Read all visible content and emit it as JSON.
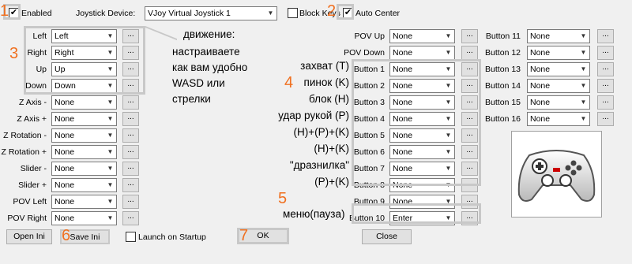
{
  "top": {
    "enabled_label": "Enabled",
    "enabled_checked": true,
    "device_label": "Joystick Device:",
    "device_value": "VJoy Virtual Joystick 1",
    "block_keys_label": "Block Keys",
    "auto_center_label": "Auto Center",
    "auto_center_checked": true
  },
  "left_rows": [
    {
      "label": "Left",
      "value": "Left"
    },
    {
      "label": "Right",
      "value": "Right"
    },
    {
      "label": "Up",
      "value": "Up"
    },
    {
      "label": "Down",
      "value": "Down"
    },
    {
      "label": "Z Axis -",
      "value": "None"
    },
    {
      "label": "Z Axis +",
      "value": "None"
    },
    {
      "label": "Z Rotation -",
      "value": "None"
    },
    {
      "label": "Z Rotation +",
      "value": "None"
    },
    {
      "label": "Slider -",
      "value": "None"
    },
    {
      "label": "Slider +",
      "value": "None"
    },
    {
      "label": "POV Left",
      "value": "None"
    },
    {
      "label": "POV Right",
      "value": "None"
    }
  ],
  "mid_rows": [
    {
      "label": "POV Up",
      "value": "None"
    },
    {
      "label": "POV Down",
      "value": "None"
    },
    {
      "label": "Button 1",
      "value": "None"
    },
    {
      "label": "Button 2",
      "value": "None"
    },
    {
      "label": "Button 3",
      "value": "None"
    },
    {
      "label": "Button 4",
      "value": "None"
    },
    {
      "label": "Button 5",
      "value": "None"
    },
    {
      "label": "Button 6",
      "value": "None"
    },
    {
      "label": "Button 7",
      "value": "None"
    },
    {
      "label": "Button 8",
      "value": "None"
    },
    {
      "label": "Button 9",
      "value": "None"
    },
    {
      "label": "Button 10",
      "value": "Enter"
    }
  ],
  "right_rows": [
    {
      "label": "Button 11",
      "value": "None"
    },
    {
      "label": "Button 12",
      "value": "None"
    },
    {
      "label": "Button 13",
      "value": "None"
    },
    {
      "label": "Button 14",
      "value": "None"
    },
    {
      "label": "Button 15",
      "value": "None"
    },
    {
      "label": "Button 16",
      "value": "None"
    }
  ],
  "dots_label": "...",
  "bottom": {
    "open_ini": "Open Ini",
    "save_ini": "Save Ini",
    "launch_label": "Launch on Startup",
    "ok": "OK",
    "close": "Close"
  },
  "annotations": {
    "movement_title": "движение:",
    "movement_l1": "настраиваете",
    "movement_l2": "как вам удобно",
    "movement_l3": "WASD или",
    "movement_l4": "стрелки",
    "button_notes": [
      "захват (T)",
      "пинок (K)",
      "блок (H)",
      "удар рукой (P)",
      "(H)+(P)+(K)",
      "(H)+(K)",
      "\"дразнилка\"",
      "(P)+(K)"
    ],
    "menu_note": "меню(пауза)",
    "numbers": [
      "1",
      "2",
      "3",
      "4",
      "5",
      "6",
      "7"
    ]
  },
  "icons": {
    "dropdown": "chevron-down-icon",
    "check": "check-icon",
    "gamepad": "gamepad-icon"
  }
}
